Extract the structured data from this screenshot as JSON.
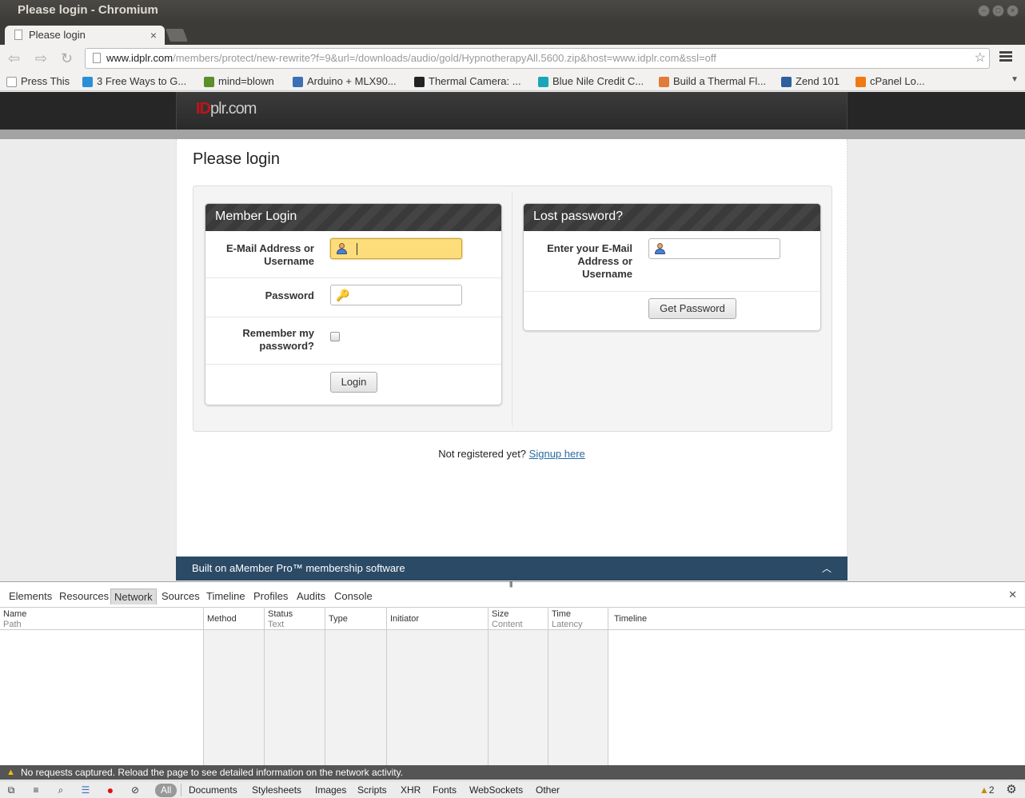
{
  "window": {
    "title": "Please login - Chromium",
    "tab_title": "Please login",
    "tab_close": "×"
  },
  "toolbar": {
    "url_host": "www.idplr.com",
    "url_path": "/members/protect/new-rewrite?f=9&url=/downloads/audio/gold/HypnotherapyAll.5600.zip&host=www.idplr.com&ssl=off"
  },
  "bookmarks": [
    {
      "label": "Press This",
      "icon_color": "#ffffff"
    },
    {
      "label": "3 Free Ways to G...",
      "icon_color": "#2a8fd6"
    },
    {
      "label": "mind=blown",
      "icon_color": "#5a8f2a"
    },
    {
      "label": "Arduino + MLX90...",
      "icon_color": "#3b6fb6"
    },
    {
      "label": "Thermal Camera: ...",
      "icon_color": "#222222"
    },
    {
      "label": "Blue Nile Credit C...",
      "icon_color": "#1aa6b7"
    },
    {
      "label": "Build a Thermal Fl...",
      "icon_color": "#e07b39"
    },
    {
      "label": "Zend 101",
      "icon_color": "#2f5f9e"
    },
    {
      "label": "cPanel Lo...",
      "icon_color": "#f07a12"
    }
  ],
  "site": {
    "logo_id": "ID",
    "logo_rest": "plr.com",
    "page_title": "Please login"
  },
  "member_login": {
    "heading": "Member Login",
    "email_label": "E-Mail Address or Username",
    "email_value": "",
    "password_label": "Password",
    "password_value": "",
    "remember_label": "Remember my password?",
    "remember_checked": false,
    "login_button": "Login"
  },
  "lost_password": {
    "heading": "Lost password?",
    "email_label": "Enter your E-Mail Address or Username",
    "email_value": "",
    "button": "Get Password"
  },
  "signup": {
    "text": "Not registered yet?",
    "link": "Signup here"
  },
  "footer": {
    "text": "Built on aMember Pro™ membership software"
  },
  "devtools": {
    "tabs": [
      "Elements",
      "Resources",
      "Network",
      "Sources",
      "Timeline",
      "Profiles",
      "Audits",
      "Console"
    ],
    "active_tab": "Network",
    "columns": [
      {
        "main": "Name",
        "sub": "Path"
      },
      {
        "main": "Method",
        "sub": ""
      },
      {
        "main": "Status",
        "sub": "Text"
      },
      {
        "main": "Type",
        "sub": ""
      },
      {
        "main": "Initiator",
        "sub": ""
      },
      {
        "main": "Size",
        "sub": "Content"
      },
      {
        "main": "Time",
        "sub": "Latency"
      },
      {
        "main": "Timeline",
        "sub": ""
      }
    ],
    "status_message": "No requests captured. Reload the page to see detailed information on the network activity.",
    "filters": [
      "All",
      "Documents",
      "Stylesheets",
      "Images",
      "Scripts",
      "XHR",
      "Fonts",
      "WebSockets",
      "Other"
    ],
    "warning_count": "2"
  }
}
